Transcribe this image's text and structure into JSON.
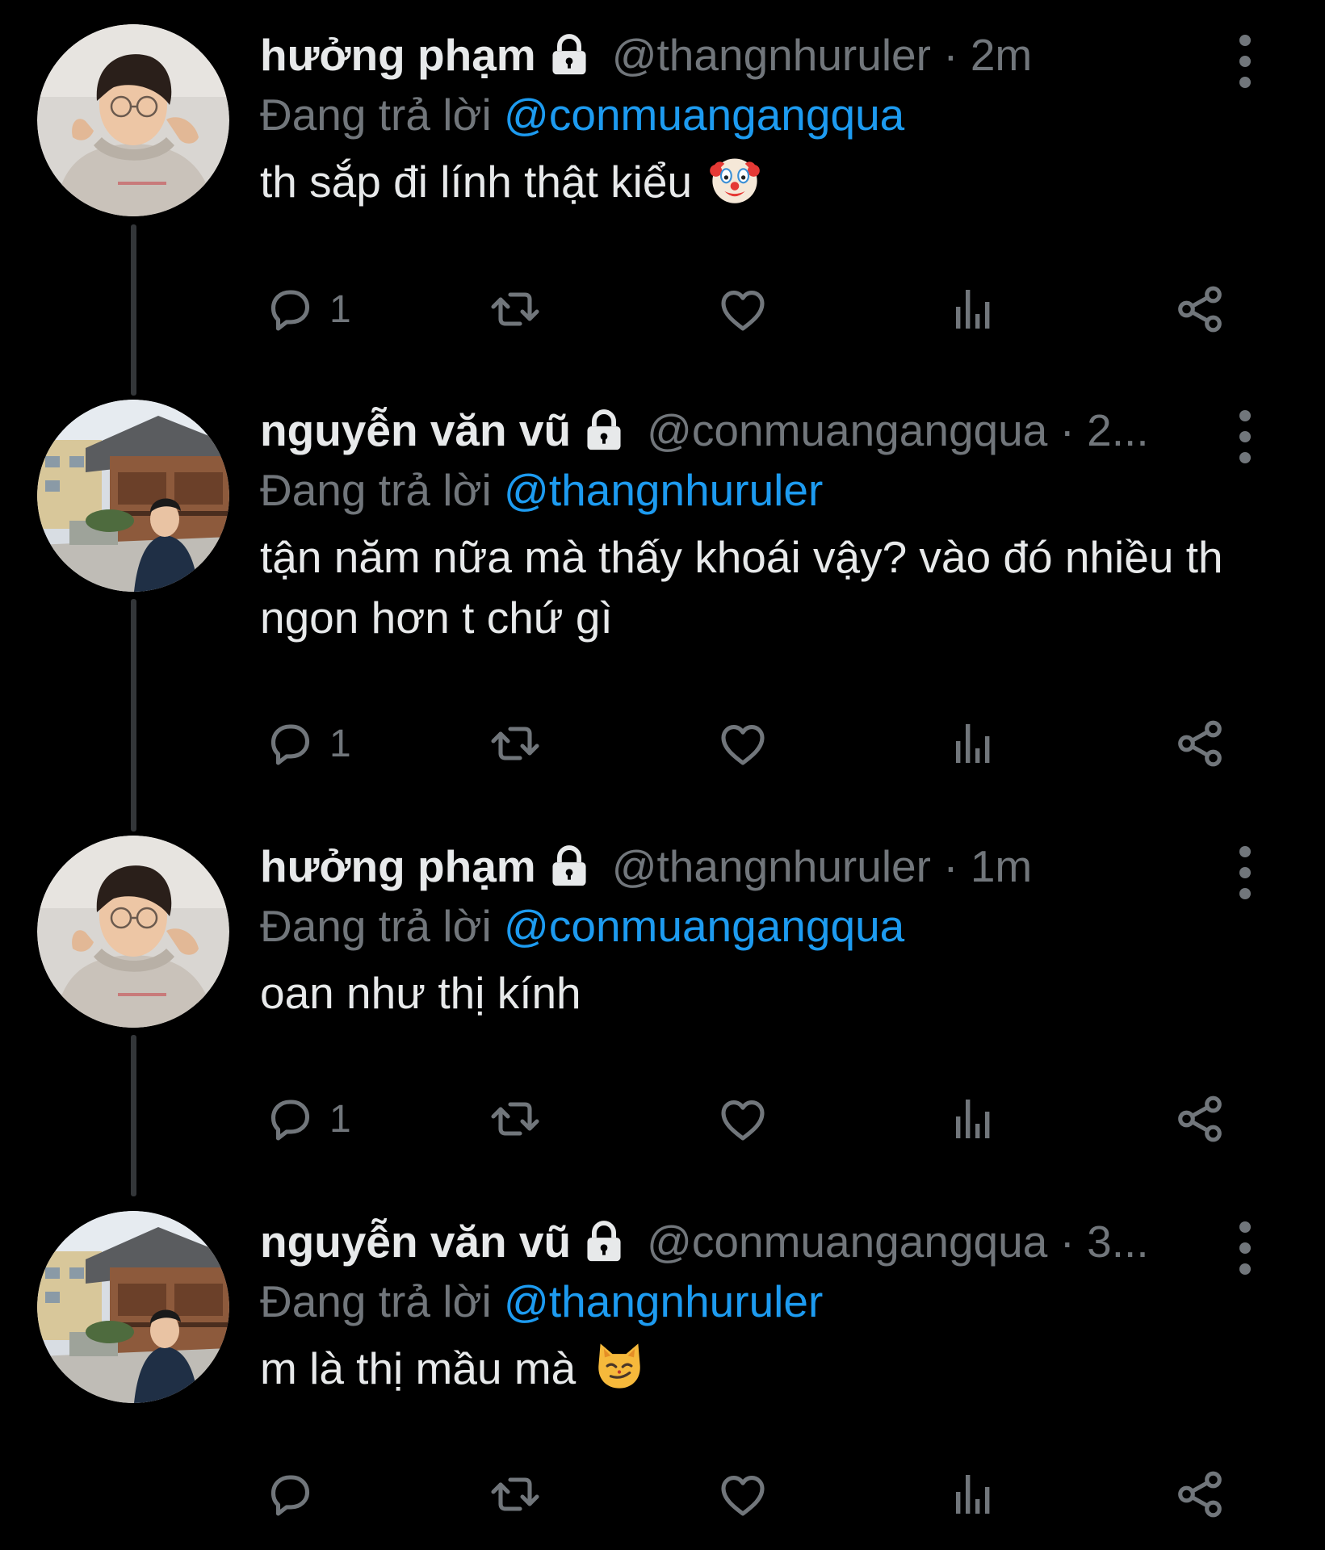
{
  "tweets": [
    {
      "name": "hưởng phạm",
      "handle_time": "@thangnhuruler · 2m",
      "replying_prefix": "Đang trả lời",
      "replying_to": "@conmuangangqua",
      "text": "th sắp đi lính thật kiểu",
      "emoji": "clown-face-emoji",
      "reply_count": "1",
      "avatar": "avatar-boy-hoodie"
    },
    {
      "name": "nguyễn văn vũ",
      "handle_time": "@conmuangangqua · 2...",
      "replying_prefix": "Đang trả lời",
      "replying_to": "@thangnhuruler",
      "text": "tận năm nữa mà thấy khoái vậy? vào đó nhiều th ngon hơn t chứ gì",
      "emoji": "",
      "reply_count": "1",
      "avatar": "avatar-street-houses"
    },
    {
      "name": "hưởng phạm",
      "handle_time": "@thangnhuruler · 1m",
      "replying_prefix": "Đang trả lời",
      "replying_to": "@conmuangangqua",
      "text": "oan như thị kính",
      "emoji": "",
      "reply_count": "1",
      "avatar": "avatar-boy-hoodie"
    },
    {
      "name": "nguyễn văn vũ",
      "handle_time": "@conmuangangqua · 3...",
      "replying_prefix": "Đang trả lời",
      "replying_to": "@thangnhuruler",
      "text": "m là thị mầu mà",
      "emoji": "smirking-cat-emoji",
      "reply_count": "",
      "avatar": "avatar-street-houses"
    }
  ],
  "icons": {
    "lock": "lock-icon",
    "more": "more-vertical-icon",
    "reply": "reply-bubble-icon",
    "retweet": "retweet-icon",
    "like": "heart-icon",
    "views": "analytics-icon",
    "share": "share-icon"
  },
  "colors": {
    "background": "#000000",
    "primary_text": "#e7e9ea",
    "secondary_text": "#71767b",
    "accent": "#1d9bf0",
    "thread_line": "#333639"
  }
}
